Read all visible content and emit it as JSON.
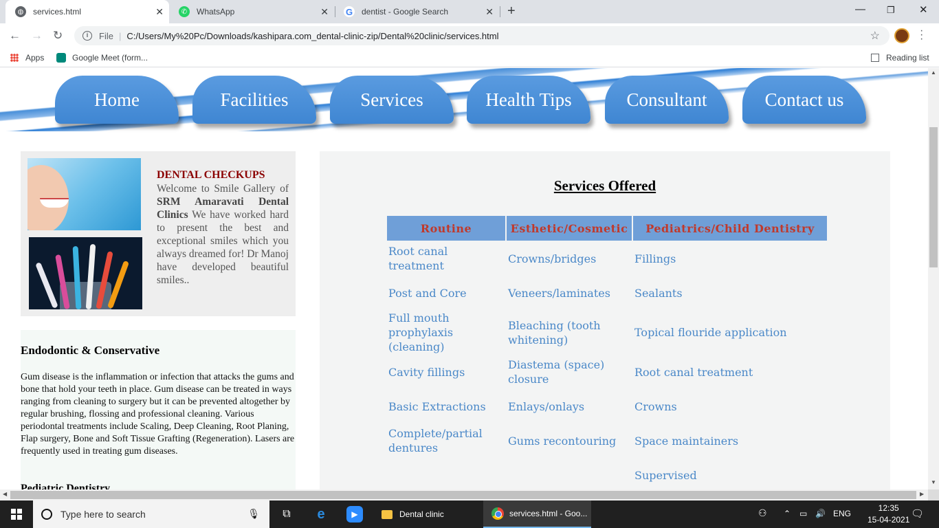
{
  "browser": {
    "tabs": [
      {
        "title": "services.html",
        "icon": "globe-icon",
        "active": true
      },
      {
        "title": "WhatsApp",
        "icon": "whatsapp-icon",
        "active": false
      },
      {
        "title": "dentist - Google Search",
        "icon": "google-icon",
        "active": false
      }
    ],
    "address": {
      "scheme": "File",
      "url": "C:/Users/My%20Pc/Downloads/kashipara.com_dental-clinic-zip/Dental%20clinic/services.html"
    },
    "bookmarks": [
      {
        "label": "Apps",
        "icon": "apps-grid-icon"
      },
      {
        "label": "Google Meet (form...",
        "icon": "google-meet-icon"
      }
    ],
    "reading_list": "Reading list"
  },
  "site": {
    "nav": [
      "Home",
      "Facilities",
      "Services",
      "Health Tips",
      "Consultant",
      "Contact us"
    ],
    "sidebar": {
      "checkup_title": "DENTAL CHECKUPS",
      "checkup_text_1": "Welcome to Smile Gallery of ",
      "checkup_bold": "SRM Amaravati Dental Clinics",
      "checkup_text_2": " We have worked hard to present the best and exceptional smiles which you always dreamed for! Dr Manoj have developed beautiful smiles.."
    },
    "endo": {
      "heading": "Endodontic & Conservative",
      "text": "Gum disease is the inflammation or infection that attacks the gums and bone that hold your teeth in place. Gum disease can be treated in ways ranging from cleaning to surgery but it can be prevented altogether by regular brushing, flossing and professional cleaning. Various periodontal treatments include Scaling, Deep Cleaning, Root Planing, Flap surgery, Bone and Soft Tissue Grafting (Regeneration). Lasers are frequently used in treating gum diseases.",
      "next_heading": "Pediatric Dentistry"
    },
    "services": {
      "title": "Services Offered",
      "columns": [
        "Routine",
        "Esthetic/Cosmetic",
        "Pediatrics/Child Dentistry"
      ],
      "rows": [
        [
          "Root canal treatment",
          "Crowns/bridges",
          "Fillings"
        ],
        [
          "Post and Core",
          "Veneers/laminates",
          "Sealants"
        ],
        [
          "Full mouth prophylaxis (cleaning)",
          "Bleaching (tooth whitening)",
          "Topical flouride application"
        ],
        [
          "Cavity fillings",
          "Diastema (space) closure",
          "Root canal treatment"
        ],
        [
          "Basic Extractions",
          "Enlays/onlays",
          "Crowns"
        ],
        [
          "Complete/partial dentures",
          "Gums recontouring",
          "Space maintainers"
        ],
        [
          "",
          "",
          "Supervised"
        ]
      ]
    }
  },
  "taskbar": {
    "search_placeholder": "Type here to search",
    "apps": [
      {
        "label": "Dental clinic",
        "icon": "folder-icon"
      },
      {
        "label": "services.html - Goo...",
        "icon": "chrome-icon"
      }
    ],
    "language": "ENG",
    "time": "12:35",
    "date": "15-04-2021"
  }
}
